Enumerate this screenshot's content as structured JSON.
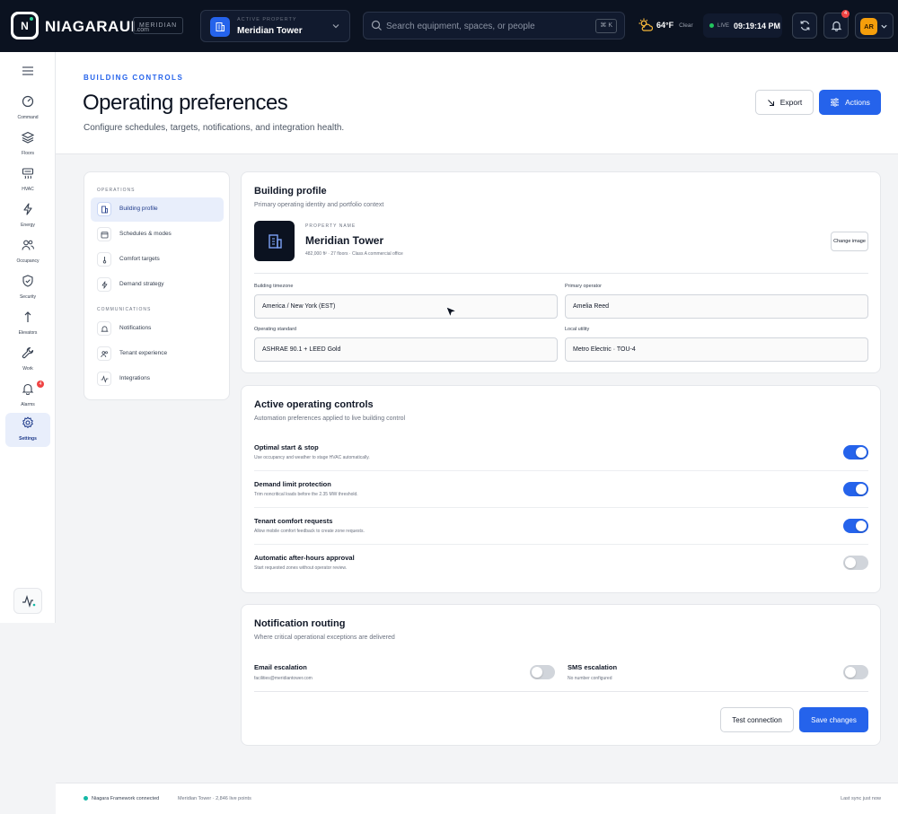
{
  "topbar": {
    "brand_main": "NIAGARA",
    "brand_ui": "UI",
    "brand_com": ".com",
    "site_badge": "MERIDIAN",
    "property_label": "ACTIVE PROPERTY",
    "property_value": "Meridian Tower",
    "search_placeholder": "Search equipment, spaces, or people",
    "search_shortcut": "⌘ K",
    "weather_temp": "64°F",
    "weather_cond": "Clear",
    "live_label": "LIVE",
    "live_time": "09:19:14 PM",
    "notification_count": "4",
    "user_initials": "AR"
  },
  "rail": {
    "items": [
      {
        "label": "Command",
        "icon": "command-icon"
      },
      {
        "label": "Floors",
        "icon": "layers-icon"
      },
      {
        "label": "HVAC",
        "icon": "hvac-icon"
      },
      {
        "label": "Energy",
        "icon": "bolt-icon"
      },
      {
        "label": "Occupancy",
        "icon": "people-icon"
      },
      {
        "label": "Security",
        "icon": "shield-icon"
      },
      {
        "label": "Elevators",
        "icon": "arrow-up-icon"
      },
      {
        "label": "Work",
        "icon": "wrench-icon"
      },
      {
        "label": "Alarms",
        "icon": "bell-icon",
        "badge": "4"
      },
      {
        "label": "Settings",
        "icon": "gear-icon",
        "active": true
      }
    ]
  },
  "header": {
    "eyebrow": "BUILDING CONTROLS",
    "title": "Operating preferences",
    "subtitle": "Configure schedules, targets, notifications, and integration health.",
    "export_label": "Export",
    "actions_label": "Actions"
  },
  "settings_nav": {
    "section_operations": "OPERATIONS",
    "section_communications": "COMMUNICATIONS",
    "items": [
      {
        "label": "Building profile",
        "active": true
      },
      {
        "label": "Schedules & modes"
      },
      {
        "label": "Comfort targets"
      },
      {
        "label": "Demand strategy"
      },
      {
        "label": "Notifications"
      },
      {
        "label": "Tenant experience"
      },
      {
        "label": "Integrations"
      }
    ]
  },
  "profile": {
    "title": "Building profile",
    "subtitle": "Primary operating identity and portfolio context",
    "property_label": "PROPERTY NAME",
    "property_name": "Meridian Tower",
    "property_meta": "482,000 ft² · 27 floors · Class A commercial office",
    "change_image_label": "Change image",
    "fields": {
      "timezone_label": "Building timezone",
      "timezone_value": "America / New York (EST)",
      "operator_label": "Primary operator",
      "operator_value": "Amelia Reed",
      "standard_label": "Operating standard",
      "standard_value": "ASHRAE 90.1 + LEED Gold",
      "utility_label": "Local utility",
      "utility_value": "Metro Electric · TOU-4"
    }
  },
  "controls": {
    "title": "Active operating controls",
    "subtitle": "Automation preferences applied to live building control",
    "rows": [
      {
        "title": "Optimal start & stop",
        "desc": "Use occupancy and weather to stage HVAC automatically.",
        "on": true
      },
      {
        "title": "Demand limit protection",
        "desc": "Trim noncritical loads before the 2.35 MW threshold.",
        "on": true
      },
      {
        "title": "Tenant comfort requests",
        "desc": "Allow mobile comfort feedback to create zone requests.",
        "on": true
      },
      {
        "title": "Automatic after-hours approval",
        "desc": "Start requested zones without operator review.",
        "on": false
      }
    ]
  },
  "notifications": {
    "title": "Notification routing",
    "subtitle": "Where critical operational exceptions are delivered",
    "email_label": "Email escalation",
    "email_value": "facilities@meridiantower.com",
    "email_on": false,
    "sms_label": "SMS escalation",
    "sms_value": "No number configured",
    "sms_on": false,
    "test_label": "Test connection",
    "save_label": "Save changes"
  },
  "footer": {
    "status": "Niagara Framework connected",
    "points": "Meridian Tower · 2,846 live points",
    "sync": "Last sync just now"
  },
  "colors": {
    "accent": "#2563eb",
    "topbar": "#0b1220",
    "live": "#22c55e",
    "alert": "#ef4444"
  }
}
